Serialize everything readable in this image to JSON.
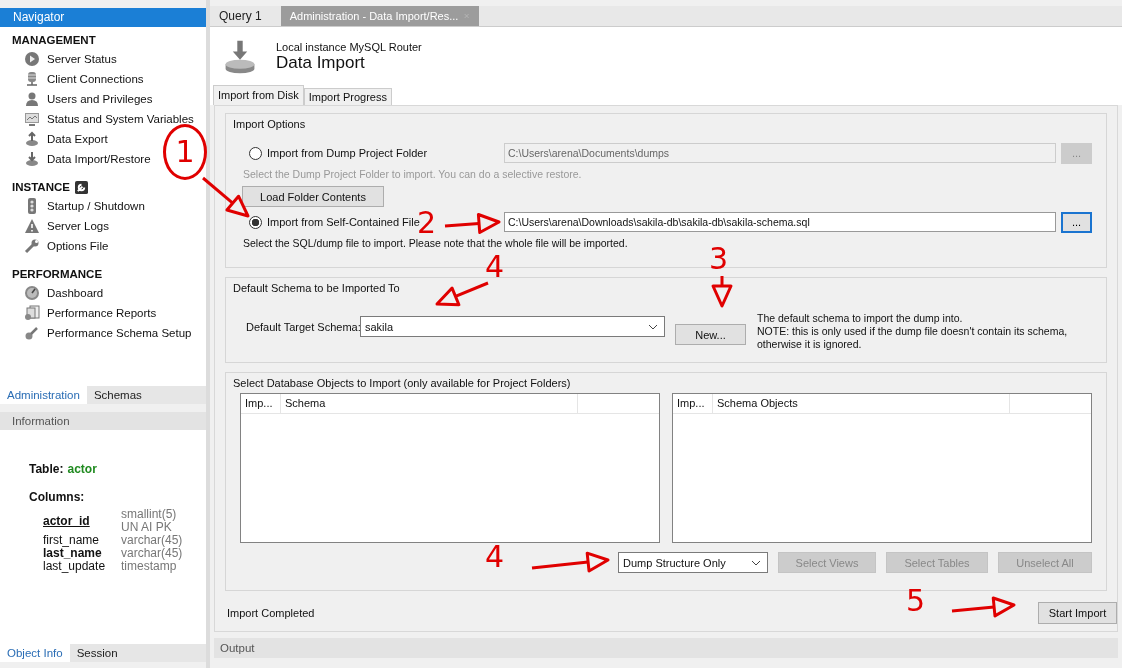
{
  "navigator": {
    "title": "Navigator",
    "sections": [
      {
        "heading": "MANAGEMENT",
        "items": [
          {
            "label": "Server Status"
          },
          {
            "label": "Client Connections"
          },
          {
            "label": "Users and Privileges"
          },
          {
            "label": "Status and System Variables"
          },
          {
            "label": "Data Export"
          },
          {
            "label": "Data Import/Restore"
          }
        ]
      },
      {
        "heading": "INSTANCE",
        "items": [
          {
            "label": "Startup / Shutdown"
          },
          {
            "label": "Server Logs"
          },
          {
            "label": "Options File"
          }
        ]
      },
      {
        "heading": "PERFORMANCE",
        "items": [
          {
            "label": "Dashboard"
          },
          {
            "label": "Performance Reports"
          },
          {
            "label": "Performance Schema Setup"
          }
        ]
      }
    ]
  },
  "sidebar_tabs": [
    {
      "label": "Administration",
      "selected": true
    },
    {
      "label": "Schemas",
      "selected": false
    }
  ],
  "information": {
    "title": "Information",
    "table_label": "Table:",
    "table_name": "actor",
    "columns_label": "Columns:",
    "columns": [
      {
        "name": "actor_id",
        "kind": "primary",
        "type": "smallint(5)",
        "flags": "UN AI PK"
      },
      {
        "name": "first_name",
        "kind": "plain",
        "type": "varchar(45)"
      },
      {
        "name": "last_name",
        "kind": "required",
        "type": "varchar(45)"
      },
      {
        "name": "last_update",
        "kind": "plain",
        "type": "timestamp"
      }
    ]
  },
  "bottom_tabs": [
    {
      "label": "Object Info",
      "selected": true
    },
    {
      "label": "Session",
      "selected": false
    }
  ],
  "editor_tabs": [
    {
      "label": "Query 1",
      "selected": false
    },
    {
      "label": "Administration - Data Import/Res...",
      "selected": true
    }
  ],
  "header": {
    "subtitle": "Local instance MySQL Router",
    "title": "Data Import"
  },
  "subtabs": [
    {
      "label": "Import from Disk",
      "selected": true
    },
    {
      "label": "Import Progress",
      "selected": false
    }
  ],
  "import_options": {
    "title": "Import Options",
    "options": [
      {
        "label": "Import from Dump Project Folder",
        "selected": false,
        "path": "C:\\Users\\arena\\Documents\\dumps",
        "browse": "...",
        "hint": "Select the Dump Project Folder to import. You can do a selective restore.",
        "button": "Load Folder Contents"
      },
      {
        "label": "Import from Self-Contained File",
        "selected": true,
        "path": "C:\\Users\\arena\\Downloads\\sakila-db\\sakila-db\\sakila-schema.sql",
        "browse": "...",
        "hint": "Select the SQL/dump file to import. Please note that the whole file will be imported."
      }
    ]
  },
  "default_schema": {
    "title": "Default Schema to be Imported To",
    "label": "Default Target Schema:",
    "value": "sakila",
    "new_button": "New...",
    "note": [
      "The default schema to import the dump into.",
      "NOTE: this is only used if the dump file doesn't contain its schema,",
      "otherwise it is ignored."
    ]
  },
  "objects": {
    "title": "Select Database Objects to Import (only available for Project Folders)",
    "left_columns": [
      "Imp...",
      "Schema"
    ],
    "right_columns": [
      "Imp...",
      "Schema Objects"
    ],
    "dump_mode": "Dump Structure Only",
    "buttons": [
      {
        "label": "Select Views",
        "disabled": true
      },
      {
        "label": "Select Tables",
        "disabled": true
      },
      {
        "label": "Unselect All",
        "disabled": true
      }
    ]
  },
  "status": "Import Completed",
  "start_button": "Start Import",
  "output": {
    "title": "Output"
  },
  "annotations": [
    {
      "text": "1"
    },
    {
      "text": "2"
    },
    {
      "text": "3"
    },
    {
      "text": "4"
    },
    {
      "text": "4"
    },
    {
      "text": "5"
    }
  ]
}
